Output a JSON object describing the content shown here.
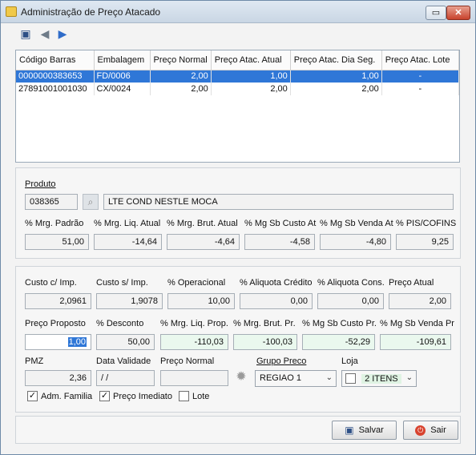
{
  "window": {
    "title": "Administração de Preço Atacado"
  },
  "toolbar": {
    "save_icon": "floppy-icon",
    "back_icon": "arrow-left-icon",
    "forward_icon": "arrow-right-icon"
  },
  "grid": {
    "columns": [
      "Código Barras",
      "Embalagem",
      "Preço Normal",
      "Preço Atac. Atual",
      "Preço Atac. Dia Seg.",
      "Preço Atac. Lote"
    ],
    "rows": [
      [
        "0000000383653",
        "FD/0006",
        "2,00",
        "1,00",
        "1,00",
        "-"
      ],
      [
        "27891001001030",
        "CX/0024",
        "2,00",
        "2,00",
        "2,00",
        "-"
      ]
    ]
  },
  "produto": {
    "label": "Produto",
    "code": "038365",
    "description": "LTE COND NESTLE MOCA",
    "margins": [
      {
        "label": "% Mrg. Padrão",
        "value": "51,00"
      },
      {
        "label": "% Mrg. Liq. Atual",
        "value": "-14,64"
      },
      {
        "label": "% Mrg. Brut. Atual",
        "value": "-4,64"
      },
      {
        "label": "% Mg Sb Custo At",
        "value": "-4,58"
      },
      {
        "label": "% Mg Sb Venda At",
        "value": "-4,80"
      },
      {
        "label": "% PIS/COFINS",
        "value": "9,25"
      }
    ]
  },
  "precos": {
    "row1": [
      {
        "label": "Custo c/ Imp.",
        "value": "2,0961"
      },
      {
        "label": "Custo s/ Imp.",
        "value": "1,9078"
      },
      {
        "label": "% Operacional",
        "value": "10,00"
      },
      {
        "label": "% Aliquota Crédito",
        "value": "0,00"
      },
      {
        "label": "% Aliquota Cons.",
        "value": "0,00"
      },
      {
        "label": "Preço Atual",
        "value": "2,00"
      }
    ],
    "row2": [
      {
        "label": "Preço Proposto",
        "value": "1,00"
      },
      {
        "label": "% Desconto",
        "value": "50,00"
      },
      {
        "label": "% Mrg. Liq. Prop.",
        "value": "-110,03"
      },
      {
        "label": "% Mrg. Brut. Pr.",
        "value": "-100,03"
      },
      {
        "label": "% Mg Sb Custo Pr.",
        "value": "-52,29"
      },
      {
        "label": "% Mg Sb Venda Pr",
        "value": "-109,61"
      }
    ],
    "pmz_label": "PMZ",
    "pmz_value": "2,36",
    "data_validade_label": "Data Validade",
    "data_validade_value": " / /",
    "preco_normal_label": "Preço Normal",
    "preco_normal_value": "",
    "grupo_preco_label": "Grupo Preco",
    "grupo_preco_value": "REGIAO 1",
    "loja_label": "Loja",
    "loja_value": "2 ITENS"
  },
  "checks": [
    {
      "label": "Adm. Familia",
      "checked": true
    },
    {
      "label": "Preço Imediato",
      "checked": true
    },
    {
      "label": "Lote",
      "checked": false
    }
  ],
  "buttons": {
    "save": "Salvar",
    "exit": "Sair"
  }
}
